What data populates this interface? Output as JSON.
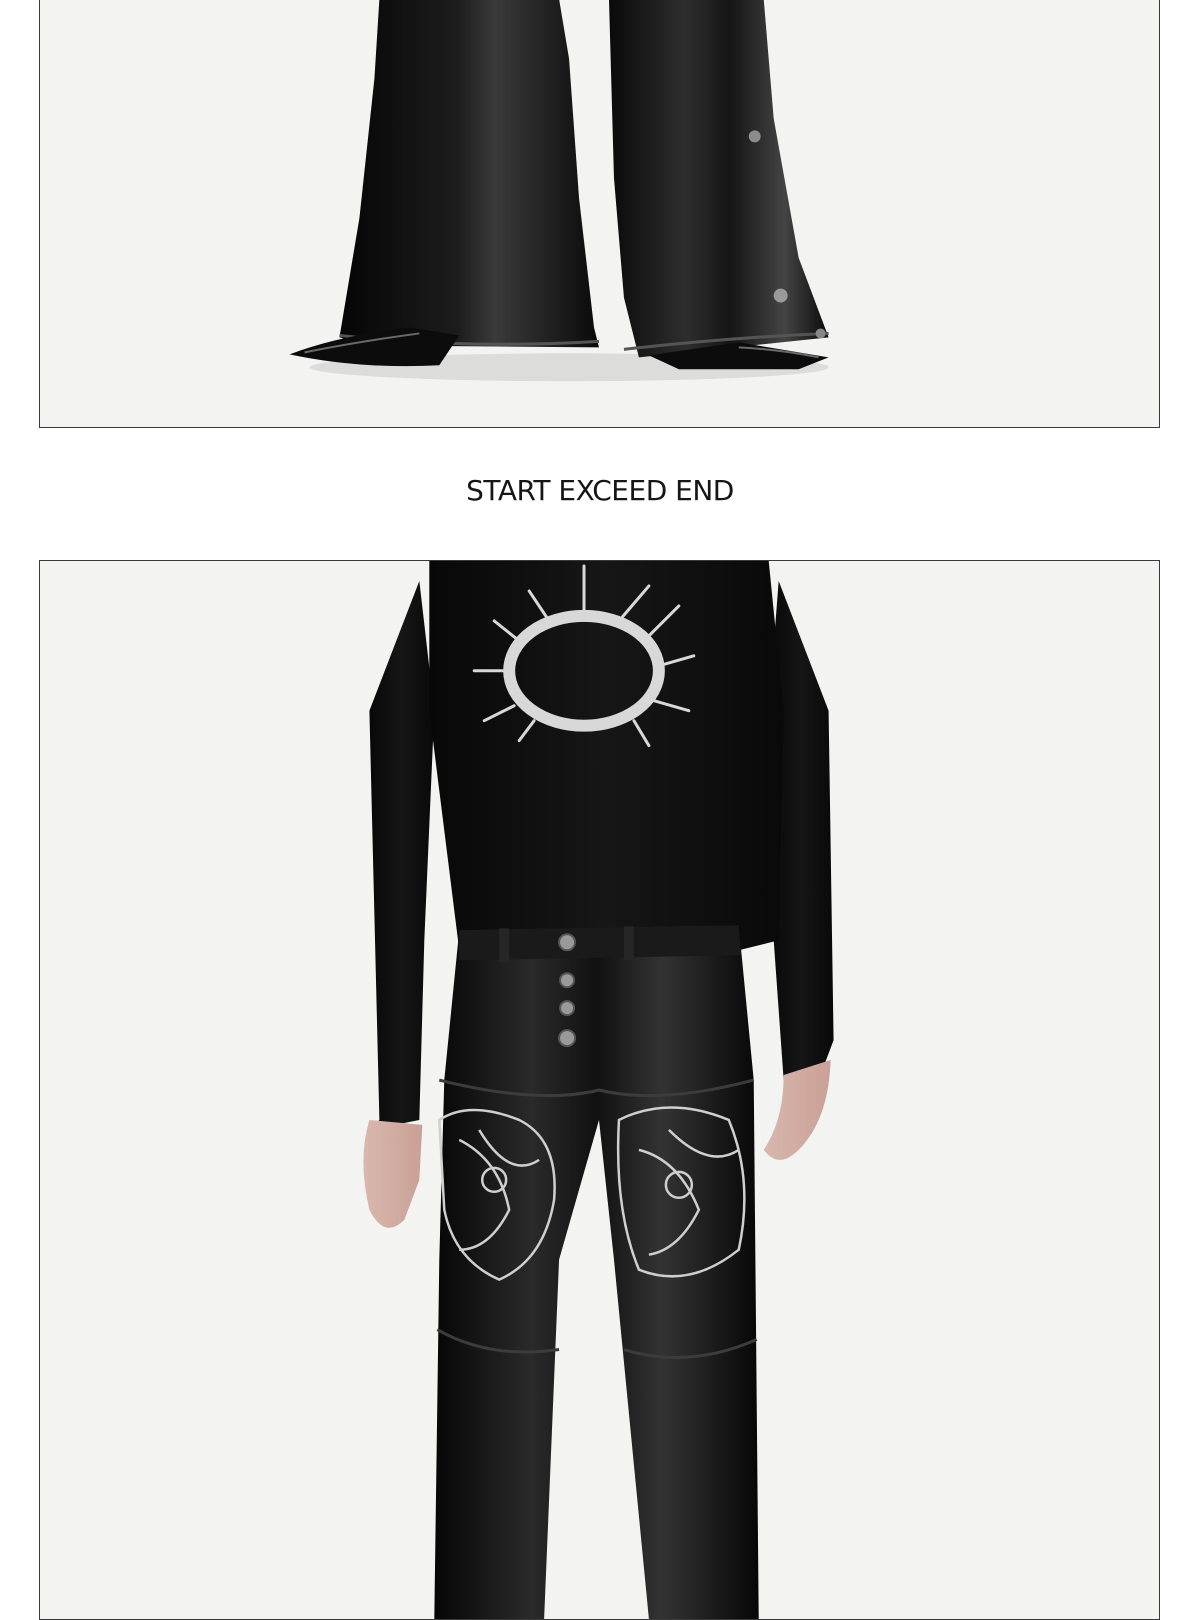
{
  "section": {
    "title": "START EXCEED END"
  },
  "photos": [
    {
      "id_name": "product-photo-flared-leather-pants-lower",
      "subject": "black leather flared trousers with pointed black leather shoes on white background"
    },
    {
      "id_name": "product-photo-embroidered-leather-pants-outfit",
      "subject": "model in black long-sleeve top with silver thorn crown print and black leather pants with silver embroidered panels and snap buttons"
    }
  ],
  "colors": {
    "background": "#ffffff",
    "photo_background": "#f3f3f1",
    "frame_border": "#3a3a3a",
    "title_text": "#161616",
    "garment_black": "#0d0d0d",
    "print_silver": "#d8d8d8"
  }
}
